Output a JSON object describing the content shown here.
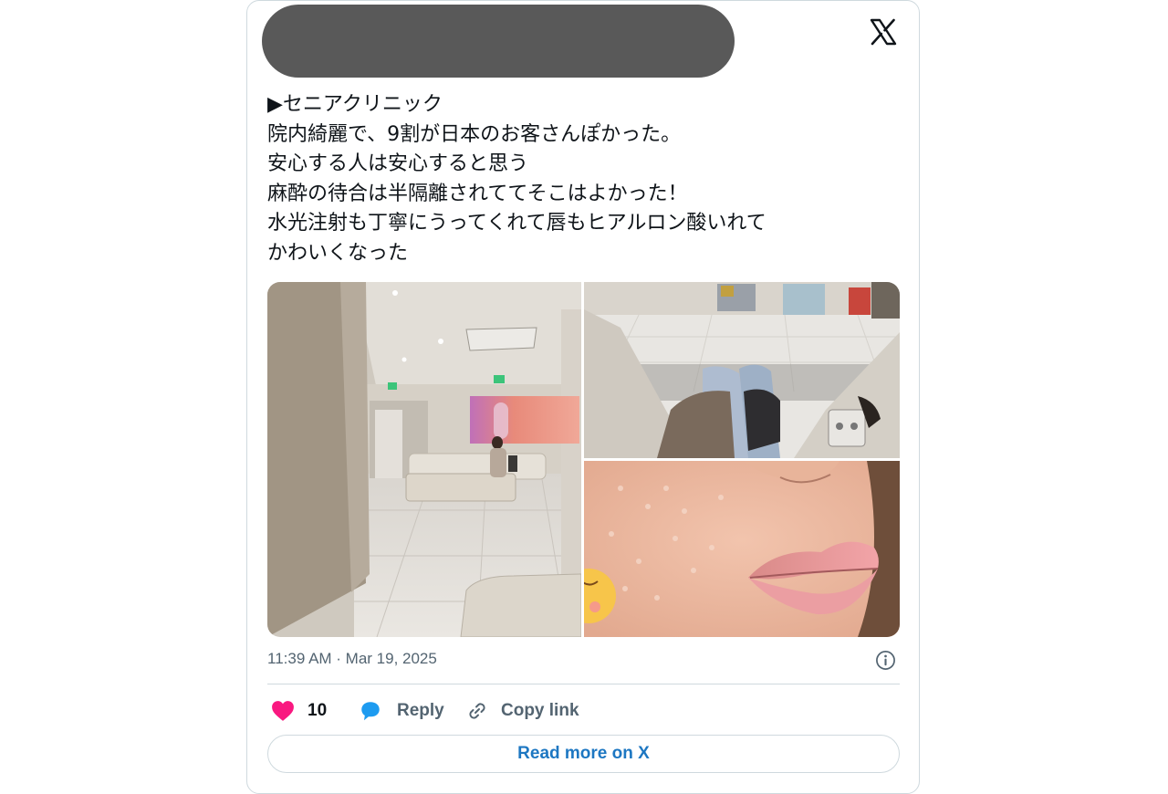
{
  "header": {
    "account_name": "",
    "logo_icon": "x-logo-icon"
  },
  "tweet": {
    "lines": [
      "▶セニアクリニック",
      "院内綺麗で、9割が日本のお客さんぽかった。",
      "安心する人は安心すると思う",
      "麻酔の待合は半隔離されててそこはよかった！",
      "水光注射も丁寧にうってくれて唇もヒアルロン酸いれて",
      "かわいくなった"
    ]
  },
  "media": {
    "count": 3,
    "icons": [
      "photo-clinic-waiting-room",
      "photo-waiting-area-legs",
      "photo-lips-closeup"
    ]
  },
  "meta": {
    "timestamp": "11:39 AM · Mar 19, 2025",
    "info_icon": "info-icon"
  },
  "actions": {
    "like_count": "10",
    "reply_label": "Reply",
    "copy_label": "Copy link"
  },
  "read_more_label": "Read more on X",
  "colors": {
    "like": "#f91880",
    "reply": "#1d9bf0",
    "link_text": "#1d77c2",
    "muted": "#536471",
    "border": "#cfd9de"
  }
}
